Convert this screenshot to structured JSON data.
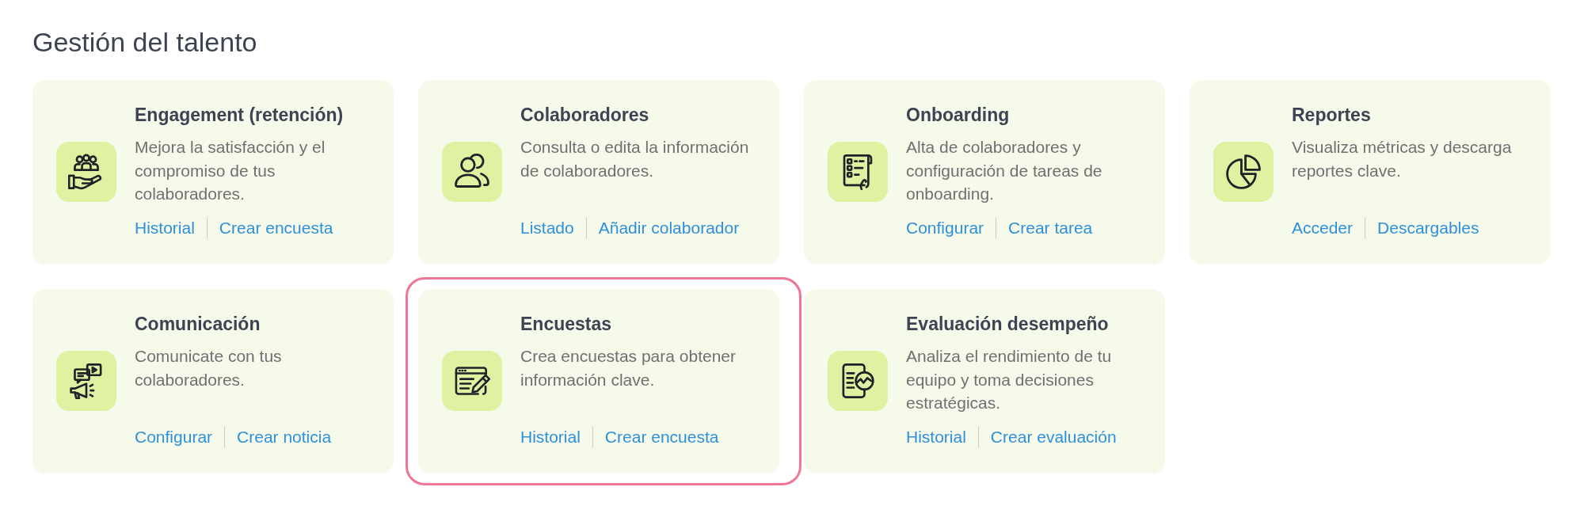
{
  "section": {
    "title": "Gestión del talento",
    "cards": [
      {
        "title": "Engagement (retención)",
        "description": "Mejora la satisfacción y el compromiso de tus colaboradores.",
        "links": [
          "Historial",
          "Crear encuesta"
        ],
        "highlighted": false
      },
      {
        "title": "Colaboradores",
        "description": "Consulta o edita la información de colaboradores.",
        "links": [
          "Listado",
          "Añadir colaborador"
        ],
        "highlighted": false
      },
      {
        "title": "Onboarding",
        "description": "Alta de colaboradores y configuración de tareas de onboarding.",
        "links": [
          "Configurar",
          "Crear tarea"
        ],
        "highlighted": false
      },
      {
        "title": "Reportes",
        "description": "Visualiza métricas y descarga reportes clave.",
        "links": [
          "Acceder",
          "Descargables"
        ],
        "highlighted": false
      },
      {
        "title": "Comunicación",
        "description": "Comunicate con tus colaboradores.",
        "links": [
          "Configurar",
          "Crear noticia"
        ],
        "highlighted": false
      },
      {
        "title": "Encuestas",
        "description": "Crea encuestas para obtener información clave.",
        "links": [
          "Historial",
          "Crear encuesta"
        ],
        "highlighted": true
      },
      {
        "title": "Evaluación desempeño",
        "description": "Analiza el rendimiento de tu equipo y toma decisiones estratégicas.",
        "links": [
          "Historial",
          "Crear evaluación"
        ],
        "highlighted": false
      }
    ]
  }
}
